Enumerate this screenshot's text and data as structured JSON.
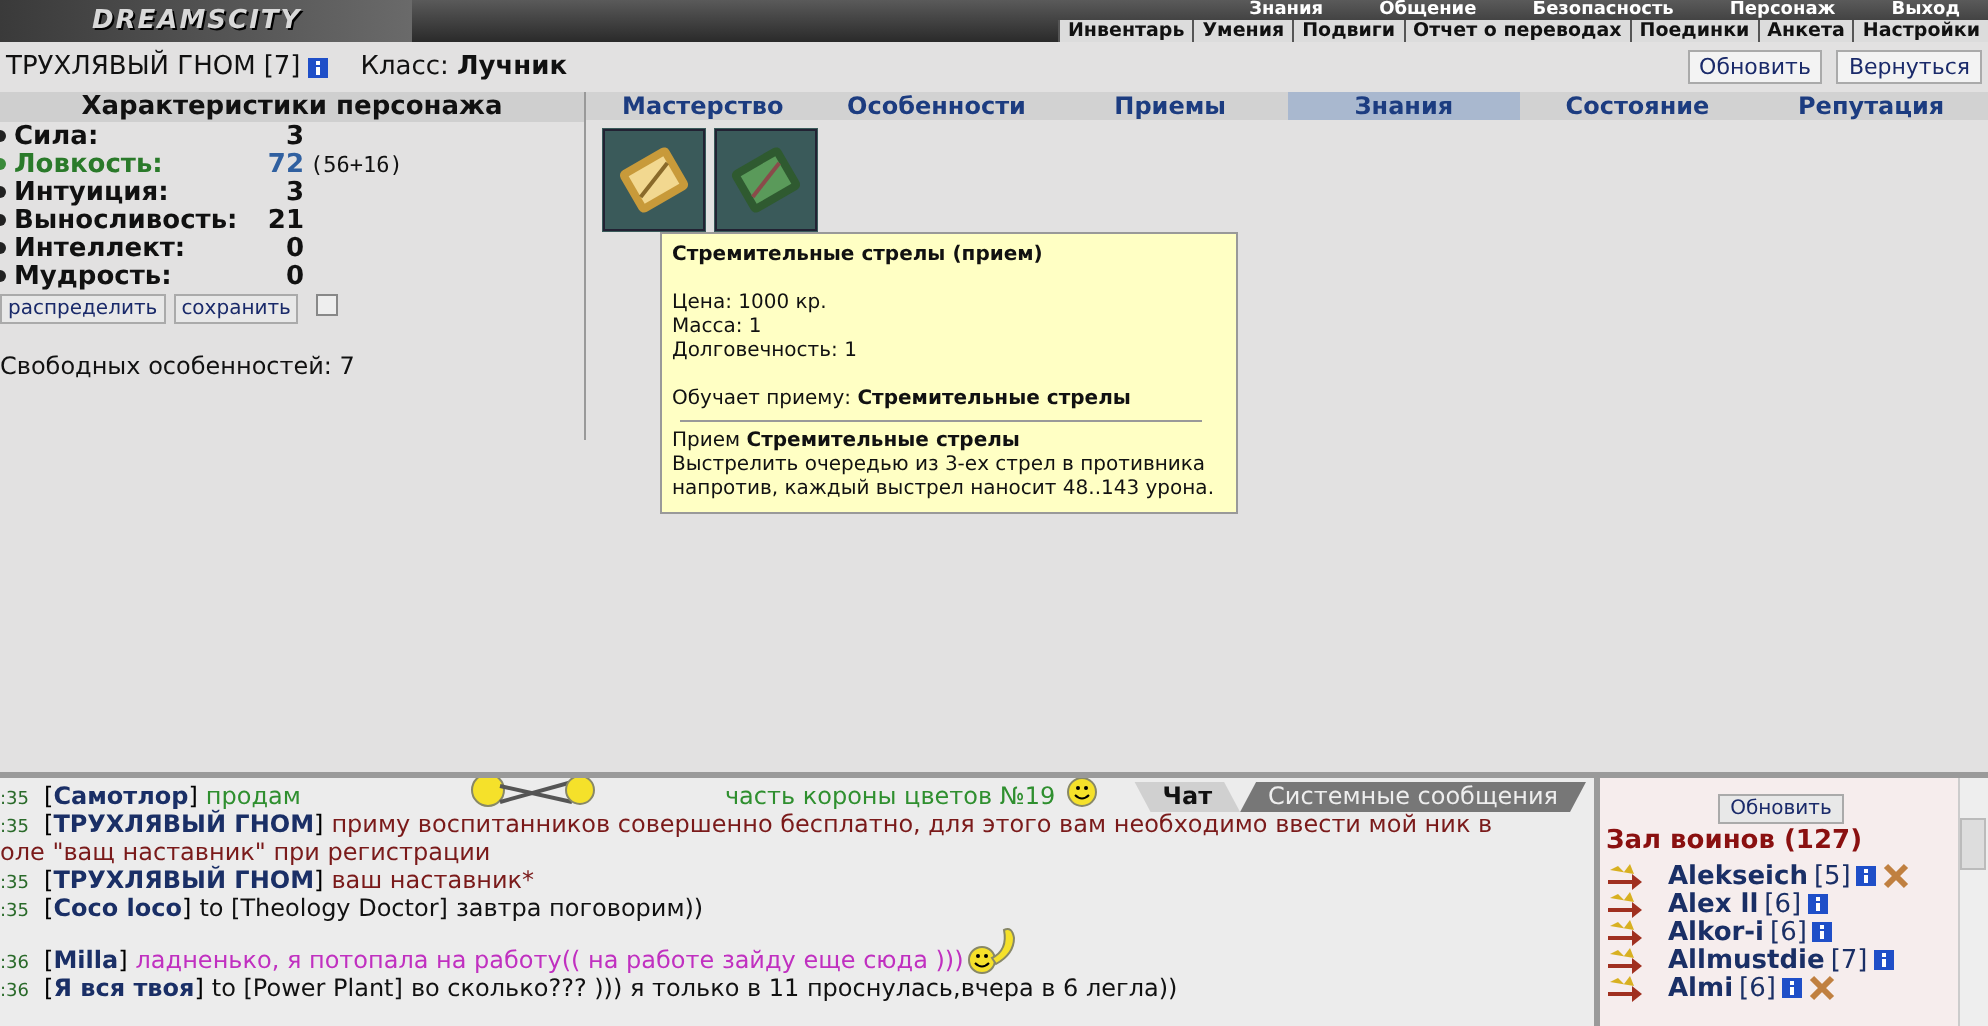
{
  "top_menu": {
    "logo": "DREAMSCITY",
    "upper_links": [
      "Знания",
      "Общение",
      "Безопасность",
      "Персонаж",
      "Выход"
    ],
    "lower_links": [
      "Инвентарь",
      "Умения",
      "Подвиги",
      "Отчет о переводах",
      "Поединки",
      "Анкета",
      "Настройки"
    ]
  },
  "character": {
    "name": "ТРУХЛЯВЫЙ ГНОМ",
    "level": "[7]",
    "class_label": "Класс:",
    "class_name": "Лучник"
  },
  "header_buttons": [
    "Обновить",
    "Вернуться"
  ],
  "stats_panel": {
    "title": "Характеристики персонажа",
    "stats": [
      {
        "name": "Сила:",
        "value": "3",
        "highlighted": false
      },
      {
        "name": "Ловкость:",
        "value": "72",
        "bonus": "(56+16)",
        "highlighted": true
      },
      {
        "name": "Интуиция:",
        "value": "3",
        "highlighted": false
      },
      {
        "name": "Выносливость:",
        "value": "21",
        "highlighted": false
      },
      {
        "name": "Интеллект:",
        "value": "0",
        "highlighted": false
      },
      {
        "name": "Мудрость:",
        "value": "0",
        "highlighted": false
      }
    ],
    "buttons": [
      "распределить",
      "сохранить"
    ],
    "checkbox": {
      "checked": false
    },
    "free_points": "Свободных особенностей: 7"
  },
  "tabs": [
    {
      "label": "Мастерство",
      "selected": false
    },
    {
      "label": "Особенности",
      "selected": false
    },
    {
      "label": "Приемы",
      "selected": false
    },
    {
      "label": "Знания",
      "selected": true
    },
    {
      "label": "Состояние",
      "selected": false
    },
    {
      "label": "Репутация",
      "selected": false
    }
  ],
  "items": [
    {
      "kind": "gold"
    },
    {
      "kind": "green"
    }
  ],
  "tooltip": {
    "title": "Стремительные стрелы (прием)",
    "lines": [
      "Цена: 1000 кр.",
      "Масса: 1",
      "Долговечность: 1"
    ],
    "teaches": "Обучает приему: **Стремительные стрелы**",
    "skill": "Прием **Стремительные стрелы**",
    "description": "Выстрелить очередью из 3-ех стрел в противника напротив, каждый выстрел наносит 48..143 урона."
  },
  "chat": {
    "tabs": [
      {
        "label": "Чат",
        "selected": true
      },
      {
        "label": "Системные сообщения",
        "selected": false
      }
    ],
    "messages": [
      {
        "time": ":35",
        "sender": "[**Самотлор**]",
        "color": "#2f8f2f",
        "parts": [
          {
            "kind": "text",
            "text": "продам"
          },
          {
            "kind": "arrows"
          },
          {
            "kind": "text",
            "text": "часть короны цветов №19"
          },
          {
            "kind": "smiley"
          }
        ]
      },
      {
        "time": ":35",
        "sender": "[**ТРУХЛЯВЫЙ ГНОМ**]",
        "color": "#7a1a1a",
        "parts": [
          {
            "kind": "text",
            "text": "приму воспитанников совершенно бесплатно, для этого вам необходимо ввести мой ник в"
          }
        ],
        "continuation": "оле \"ващ наставник\" при регистрации"
      },
      {
        "time": ":35",
        "sender": "[**ТРУХЛЯВЫЙ ГНОМ**]",
        "color": "#7a1a1a",
        "parts": [
          {
            "kind": "text",
            "text": "ваш наставник*"
          }
        ]
      },
      {
        "time": ":35",
        "sender": "[**Coco loco**]",
        "color": "#111111",
        "parts": [
          {
            "kind": "address",
            "text": "to [Theology Doctor]"
          },
          {
            "kind": "text",
            "text": "завтра поговорим))"
          }
        ]
      },
      {
        "time": ":36",
        "sender": "[**Milla**]",
        "color": "#c030c0",
        "parts": [
          {
            "kind": "text",
            "text": "ладненько, я потопала на работу(( на работе зайду еще сюда )))"
          },
          {
            "kind": "waving"
          }
        ]
      },
      {
        "time": ":36",
        "sender": "[**Я вся твоя**]",
        "color": "#111111",
        "parts": [
          {
            "kind": "address",
            "text": "to [Power Plant]"
          },
          {
            "kind": "text",
            "text": "во сколько??? ))) я только в 11 проснулась,вчера в 6 легла))"
          }
        ]
      }
    ]
  },
  "online": {
    "refresh": "Обновить",
    "title": "Зал воинов (127)",
    "players": [
      {
        "name": "Alekseich",
        "level": "[5]",
        "cross": true
      },
      {
        "name": "Alex ll",
        "level": "[6]",
        "cross": false
      },
      {
        "name": "Alkor-i",
        "level": "[6]",
        "cross": false
      },
      {
        "name": "Allmustdie",
        "level": "[7]",
        "cross": false
      },
      {
        "name": "Almi",
        "level": "[6]",
        "cross": true
      }
    ]
  }
}
